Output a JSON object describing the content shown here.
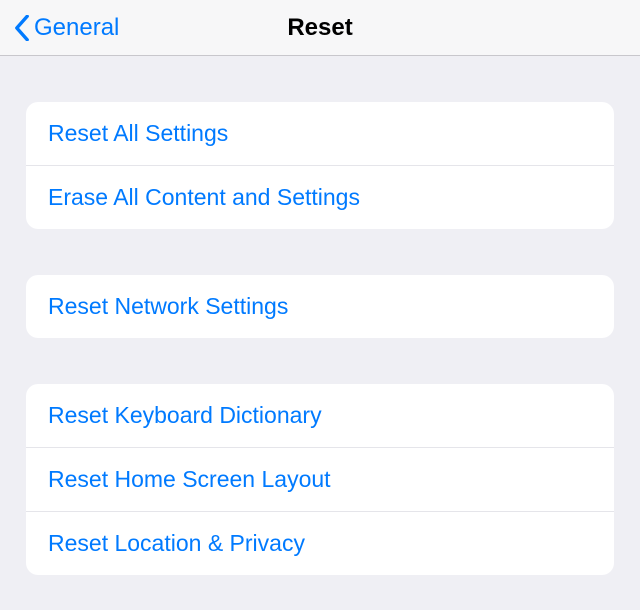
{
  "nav": {
    "back_label": "General",
    "title": "Reset"
  },
  "groups": [
    {
      "items": [
        {
          "label": "Reset All Settings"
        },
        {
          "label": "Erase All Content and Settings"
        }
      ]
    },
    {
      "items": [
        {
          "label": "Reset Network Settings"
        }
      ]
    },
    {
      "items": [
        {
          "label": "Reset Keyboard Dictionary"
        },
        {
          "label": "Reset Home Screen Layout"
        },
        {
          "label": "Reset Location & Privacy"
        }
      ]
    }
  ]
}
